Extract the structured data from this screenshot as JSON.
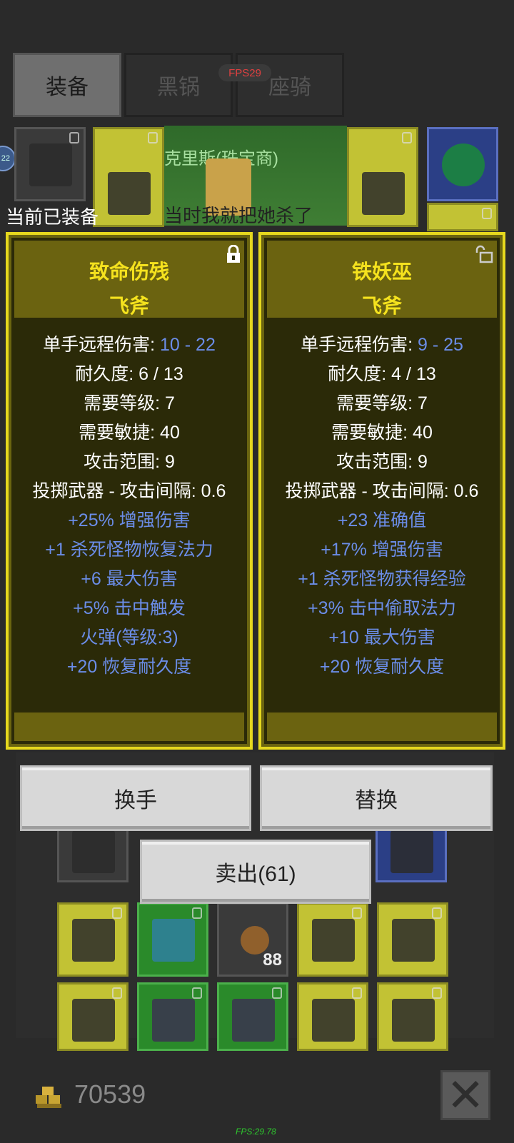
{
  "tabs": [
    {
      "label": "装备",
      "active": true
    },
    {
      "label": "黑锅",
      "active": false
    },
    {
      "label": "座骑",
      "active": false
    }
  ],
  "fps_badge": "FPS29",
  "npc": {
    "name": "克里斯(珠宝商)",
    "line": "当时我就把她杀了"
  },
  "level_badge": "22",
  "equipped_label": "当前已装备",
  "panels": [
    {
      "name": "致命伤残",
      "type": "飞斧",
      "locked": true,
      "stats": [
        {
          "label": "单手远程伤害",
          "value": "10 - 22"
        },
        {
          "label": "耐久度",
          "value": "6 / 13"
        },
        {
          "label": "需要等级",
          "value": "7"
        },
        {
          "label": "需要敏捷",
          "value": "40"
        },
        {
          "label": "攻击范围",
          "value": "9"
        },
        {
          "label": "投掷武器 - 攻击间隔",
          "value": "0.6"
        }
      ],
      "affixes": [
        "+25% 增强伤害",
        "+1 杀死怪物恢复法力",
        "+6 最大伤害",
        "+5% 击中触发",
        "火弹(等级:3)",
        "+20 恢复耐久度"
      ]
    },
    {
      "name": "铁妖巫",
      "type": "飞斧",
      "locked": false,
      "stats": [
        {
          "label": "单手远程伤害",
          "value": "9 - 25"
        },
        {
          "label": "耐久度",
          "value": "4 / 13"
        },
        {
          "label": "需要等级",
          "value": "7"
        },
        {
          "label": "需要敏捷",
          "value": "40"
        },
        {
          "label": "攻击范围",
          "value": "9"
        },
        {
          "label": "投掷武器 - 攻击间隔",
          "value": "0.6"
        }
      ],
      "affixes": [
        "+23 准确值",
        "+17% 增强伤害",
        "+1 杀死怪物获得经验",
        "+3% 击中偷取法力",
        "+10 最大伤害",
        "+20 恢复耐久度"
      ]
    }
  ],
  "buttons": {
    "swap_hand": "换手",
    "replace": "替换",
    "sell": "卖出(61)"
  },
  "inventory": {
    "stack_count": "88"
  },
  "gold": "70539",
  "fps_footer": "FPS:29.78",
  "colors": {
    "panel_border": "#e6d81e",
    "title": "#f5e21e",
    "affix": "#6b8de8",
    "unique_cell": "#c2c234",
    "set_cell": "#2a8a2a",
    "magic_cell": "#2b3f86"
  }
}
